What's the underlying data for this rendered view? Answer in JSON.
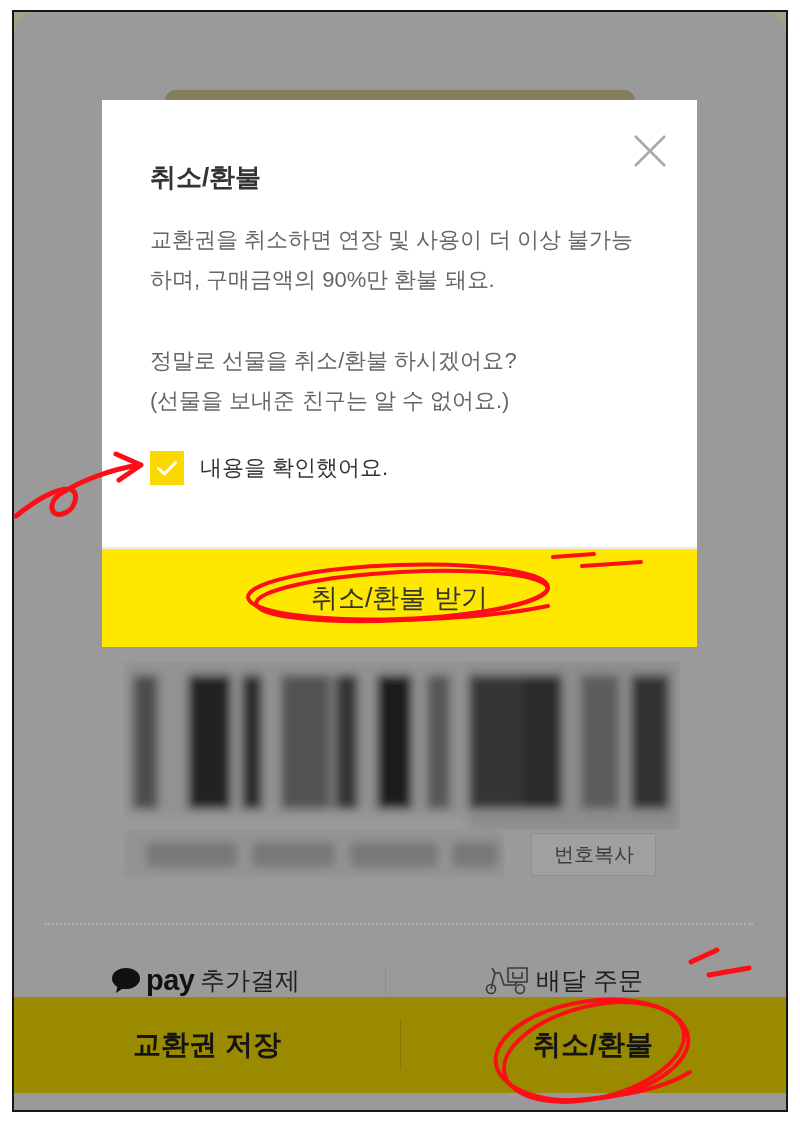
{
  "dialog": {
    "title": "취소/환불",
    "messages": [
      "교환권을 취소하면 연장 및 사용이 더 이상 불가능\n하며, 구매금액의 90%만 환불 돼요.",
      "정말로 선물을 취소/환불 하시겠어요?\n(선물을 보내준 친구는 알 수 없어요.)"
    ],
    "confirm": {
      "label": "내용을 확인했어요.",
      "checked": true
    },
    "submit_button": "취소/환불 받기"
  },
  "background_page": {
    "copy_button": "번호복사",
    "actions": [
      {
        "kind": "pay",
        "logo_text": "pay",
        "label": "추가결제"
      },
      {
        "kind": "delivery",
        "label": "배달 주문"
      }
    ],
    "bottom_buttons": [
      "교환권 저장",
      "취소/환불"
    ]
  }
}
